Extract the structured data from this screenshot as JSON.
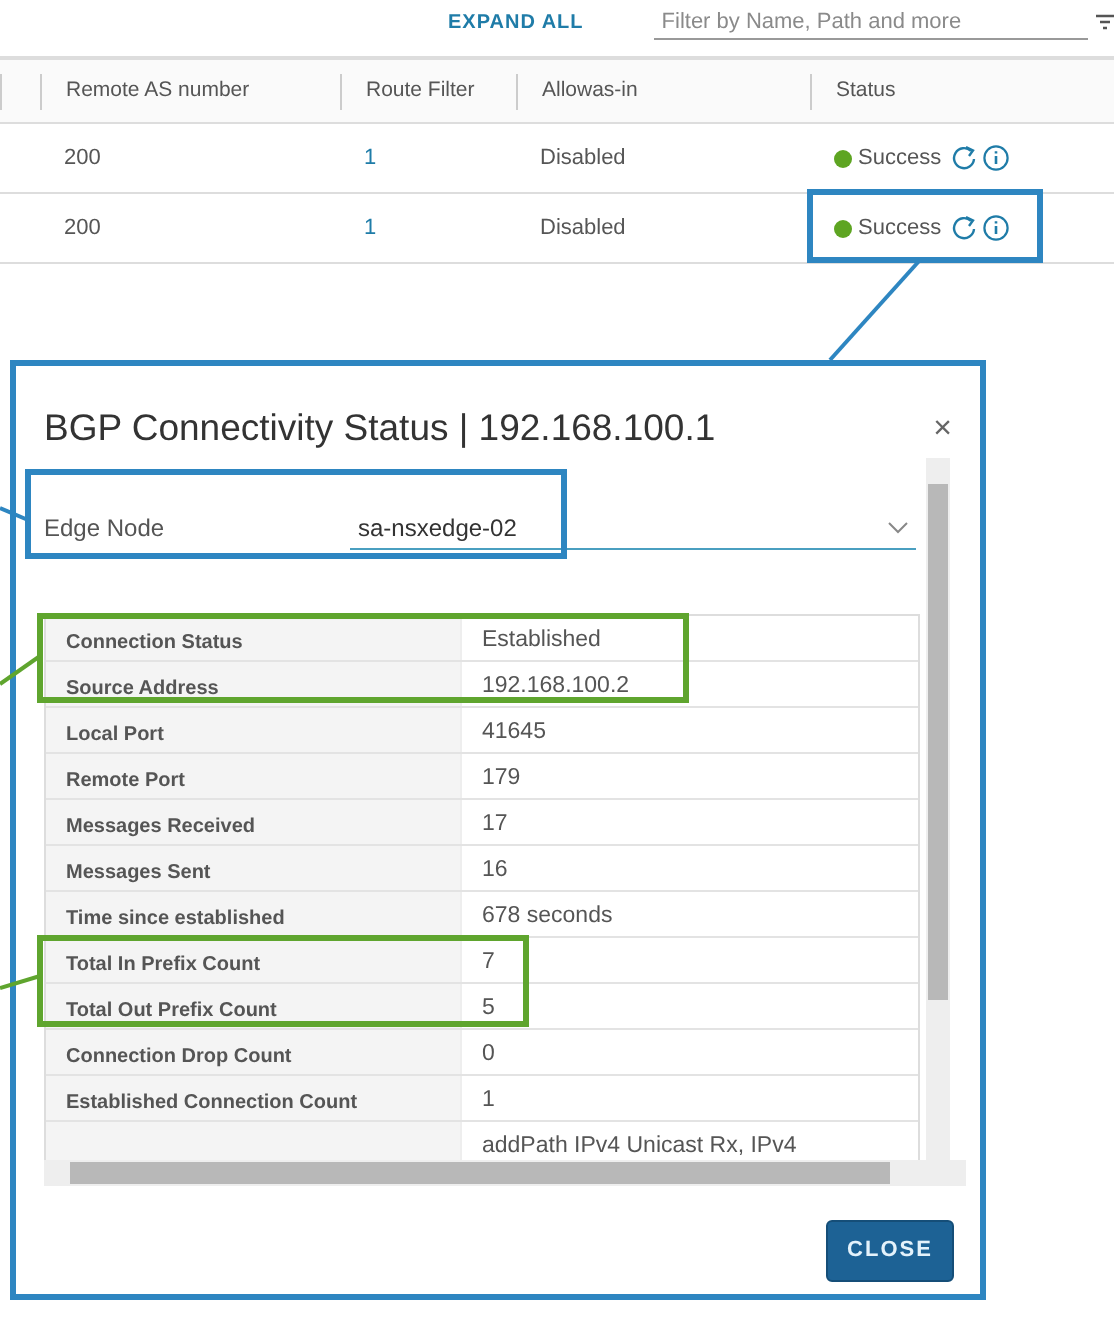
{
  "toolbar": {
    "expand_all": "EXPAND ALL",
    "filter": {
      "placeholder": "Filter by Name, Path and more"
    }
  },
  "table": {
    "columns": [
      "Remote AS number",
      "Route Filter",
      "Allowas-in",
      "Status"
    ],
    "rows": [
      {
        "remote_as": "200",
        "route_filter": "1",
        "allowas_in": "Disabled",
        "status": "Success",
        "color": "#5ea522"
      },
      {
        "remote_as": "200",
        "route_filter": "1",
        "allowas_in": "Disabled",
        "status": "Success",
        "color": "#5ea522"
      }
    ]
  },
  "dialog": {
    "title": "BGP Connectivity Status | 192.168.100.1",
    "edge_node": {
      "label": "Edge Node",
      "value": "sa-nsxedge-02"
    },
    "properties": [
      {
        "label": "Connection Status",
        "value": "Established"
      },
      {
        "label": "Source Address",
        "value": "192.168.100.2"
      },
      {
        "label": "Local Port",
        "value": "41645"
      },
      {
        "label": "Remote Port",
        "value": "179"
      },
      {
        "label": "Messages Received",
        "value": "17"
      },
      {
        "label": "Messages Sent",
        "value": "16"
      },
      {
        "label": "Time since established",
        "value": "678 seconds"
      },
      {
        "label": "Total In Prefix Count",
        "value": "7"
      },
      {
        "label": "Total Out Prefix Count",
        "value": "5"
      },
      {
        "label": "Connection Drop Count",
        "value": "0"
      },
      {
        "label": "Established Connection Count",
        "value": "1"
      },
      {
        "value": "addPath IPv4 Unicast Rx, IPv4"
      }
    ],
    "close_icon": "×",
    "close_button": "CLOSE"
  },
  "annotations": [
    {
      "color": "#2e86c1"
    },
    {
      "color": "#2e86c1"
    },
    {
      "color": "#5fa52e"
    },
    {
      "color": "#5fa52e"
    }
  ]
}
